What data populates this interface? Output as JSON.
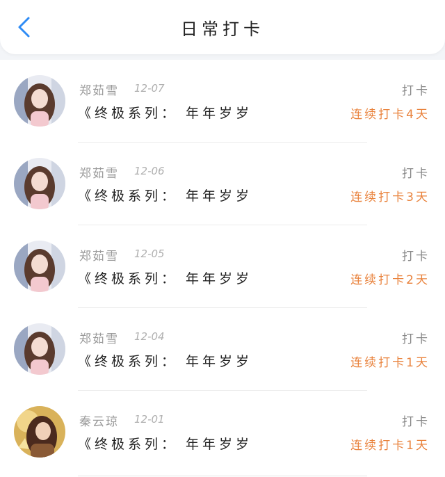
{
  "header": {
    "title": "日常打卡",
    "back_icon": "chevron-left-icon",
    "accent": "#2f8cf5"
  },
  "entries": [
    {
      "name": "郑茹雪",
      "date": "12-07",
      "book": "《终极系列： 年年岁岁",
      "type": "打卡",
      "streak": "连续打卡4天",
      "avatar": "girl-portrait"
    },
    {
      "name": "郑茹雪",
      "date": "12-06",
      "book": "《终极系列： 年年岁岁",
      "type": "打卡",
      "streak": "连续打卡3天",
      "avatar": "girl-portrait"
    },
    {
      "name": "郑茹雪",
      "date": "12-05",
      "book": "《终极系列： 年年岁岁",
      "type": "打卡",
      "streak": "连续打卡2天",
      "avatar": "girl-portrait"
    },
    {
      "name": "郑茹雪",
      "date": "12-04",
      "book": "《终极系列： 年年岁岁",
      "type": "打卡",
      "streak": "连续打卡1天",
      "avatar": "girl-portrait"
    },
    {
      "name": "秦云琼",
      "date": "12-01",
      "book": "《终极系列： 年年岁岁",
      "type": "打卡",
      "streak": "连续打卡1天",
      "avatar": "illustrated-portrait"
    }
  ],
  "colors": {
    "streak": "#e9823c",
    "name": "#9a9a9a",
    "text": "#222222"
  }
}
